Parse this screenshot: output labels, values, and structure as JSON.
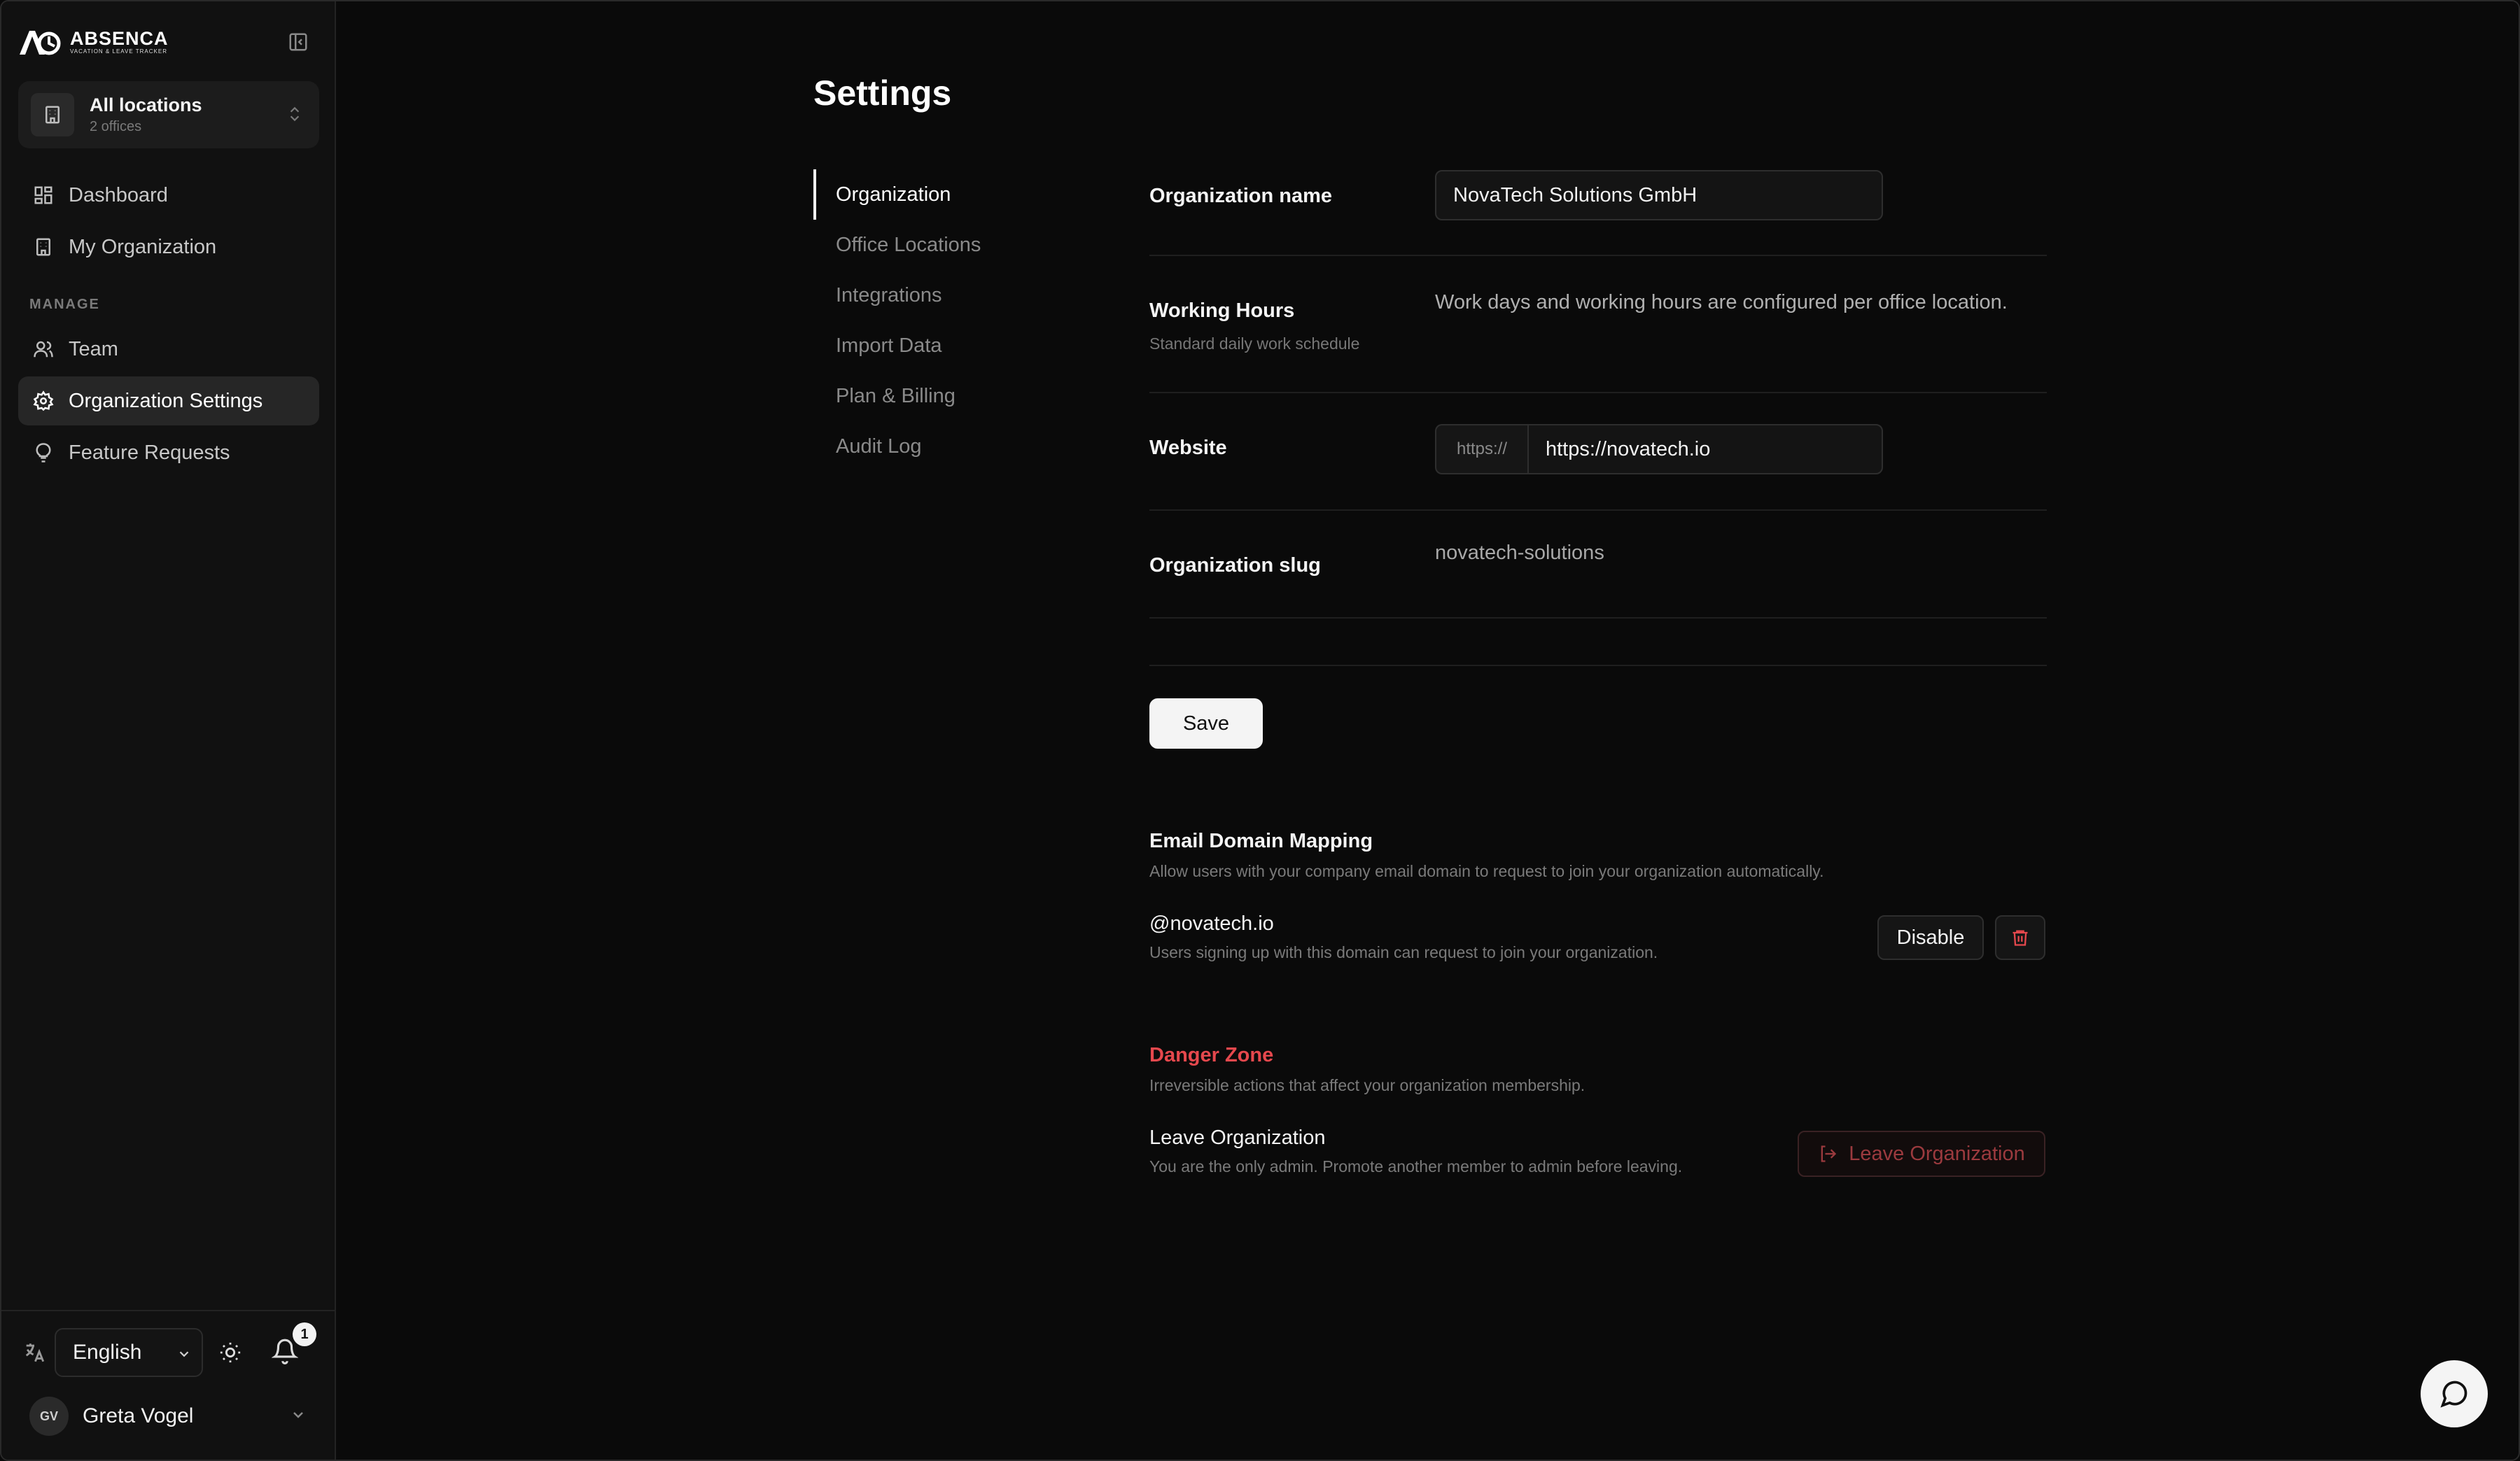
{
  "app": {
    "logo_name": "ABSENCA",
    "logo_tagline": "VACATION & LEAVE TRACKER"
  },
  "location_switcher": {
    "title": "All locations",
    "subtitle": "2 offices"
  },
  "sidebar": {
    "items": [
      {
        "label": "Dashboard",
        "icon": "dashboard-icon"
      },
      {
        "label": "My Organization",
        "icon": "building-icon"
      }
    ],
    "manage_heading": "MANAGE",
    "manage_items": [
      {
        "label": "Team",
        "icon": "users-icon"
      },
      {
        "label": "Organization Settings",
        "icon": "gear-icon",
        "active": true
      },
      {
        "label": "Feature Requests",
        "icon": "lightbulb-icon"
      }
    ],
    "language": "English",
    "notification_count": "1",
    "user": {
      "initials": "GV",
      "name": "Greta Vogel"
    }
  },
  "page": {
    "title": "Settings"
  },
  "subnav": [
    {
      "label": "Organization",
      "active": true
    },
    {
      "label": "Office Locations"
    },
    {
      "label": "Integrations"
    },
    {
      "label": "Import Data"
    },
    {
      "label": "Plan & Billing"
    },
    {
      "label": "Audit Log"
    }
  ],
  "form": {
    "org_name_label": "Organization name",
    "org_name_value": "NovaTech Solutions GmbH",
    "working_hours_label": "Working Hours",
    "working_hours_sub": "Standard daily work schedule",
    "working_hours_text": "Work days and working hours are configured per office location.",
    "website_label": "Website",
    "website_prefix": "https://",
    "website_value": "https://novatech.io",
    "slug_label": "Organization slug",
    "slug_value": "novatech-solutions",
    "save_label": "Save"
  },
  "email_domain": {
    "title": "Email Domain Mapping",
    "description": "Allow users with your company email domain to request to join your organization automatically.",
    "domain": "@novatech.io",
    "domain_desc": "Users signing up with this domain can request to join your organization.",
    "disable_label": "Disable"
  },
  "danger_zone": {
    "title": "Danger Zone",
    "description": "Irreversible actions that affect your organization membership.",
    "leave_title": "Leave Organization",
    "leave_desc": "You are the only admin. Promote another member to admin before leaving.",
    "leave_button": "Leave Organization"
  },
  "colors": {
    "background": "#0a0a0a",
    "sidebar": "#111111",
    "danger": "#e5484d"
  }
}
